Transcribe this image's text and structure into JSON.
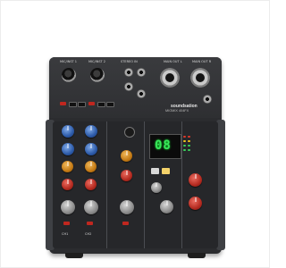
{
  "product": {
    "brand": "soundsation",
    "model": "MIOMIX 404FX",
    "display_value": "08",
    "labels": {
      "ch1": "MIC/INST 1",
      "ch2": "MIC/INST 2",
      "stereo": "STEREO IN",
      "main_l": "MAIN OUT L",
      "main_r": "MAIN OUT R",
      "ch1_short": "CH1",
      "ch2_short": "CH2"
    }
  },
  "colors": {
    "body": "#2b2c2f",
    "display_digits": "#38e55a",
    "knob_blue": "#2c5aa8",
    "knob_orange": "#c47a14",
    "knob_red": "#b42a20",
    "knob_gray": "#8b8b8b"
  }
}
